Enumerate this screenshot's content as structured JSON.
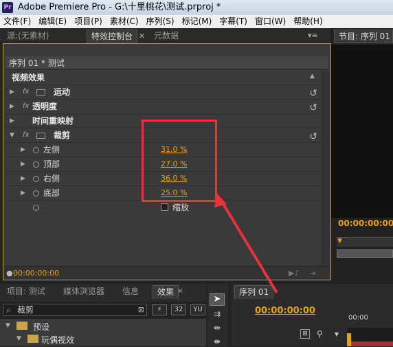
{
  "window": {
    "title": "Adobe Premiere Pro - G:\\十里桃花\\测试.prproj *",
    "app_icon": "Pr"
  },
  "menu": [
    "文件(F)",
    "编辑(E)",
    "项目(P)",
    "素材(C)",
    "序列(S)",
    "标记(M)",
    "字幕(T)",
    "窗口(W)",
    "帮助(H)"
  ],
  "top_tabs": {
    "source": "源:(无素材)",
    "effect_controls": "特效控制台",
    "metadata": "元数据",
    "program": "节目: 序列 01"
  },
  "effect_controls": {
    "sequence": "序列 01 * 测试",
    "section": "视频效果",
    "effects": [
      "运动",
      "透明度",
      "时间重映射",
      "裁剪"
    ],
    "fx": "fx",
    "crop_params": [
      {
        "label": "左侧",
        "value": "31.0 %"
      },
      {
        "label": "顶部",
        "value": "27.0 %"
      },
      {
        "label": "右侧",
        "value": "36.0 %"
      },
      {
        "label": "底部",
        "value": "25.0 %"
      }
    ],
    "zoom_label": "缩放",
    "timecode": "00:00:00:00"
  },
  "program_timecode": "00:00:00:00",
  "bottom_tabs": {
    "project": "项目: 测试",
    "media_browser": "媒体浏览器",
    "info": "信息",
    "effects": "效果",
    "btn32": "32",
    "btnyu": "YU"
  },
  "search": {
    "value": "裁剪"
  },
  "tree": [
    "预设",
    "玩偶视效"
  ],
  "sequence_panel": {
    "tab": "序列 01",
    "timecode": "00:00:00:00",
    "ruler": "00:00"
  },
  "highlight": {
    "color": "#e8323c"
  }
}
